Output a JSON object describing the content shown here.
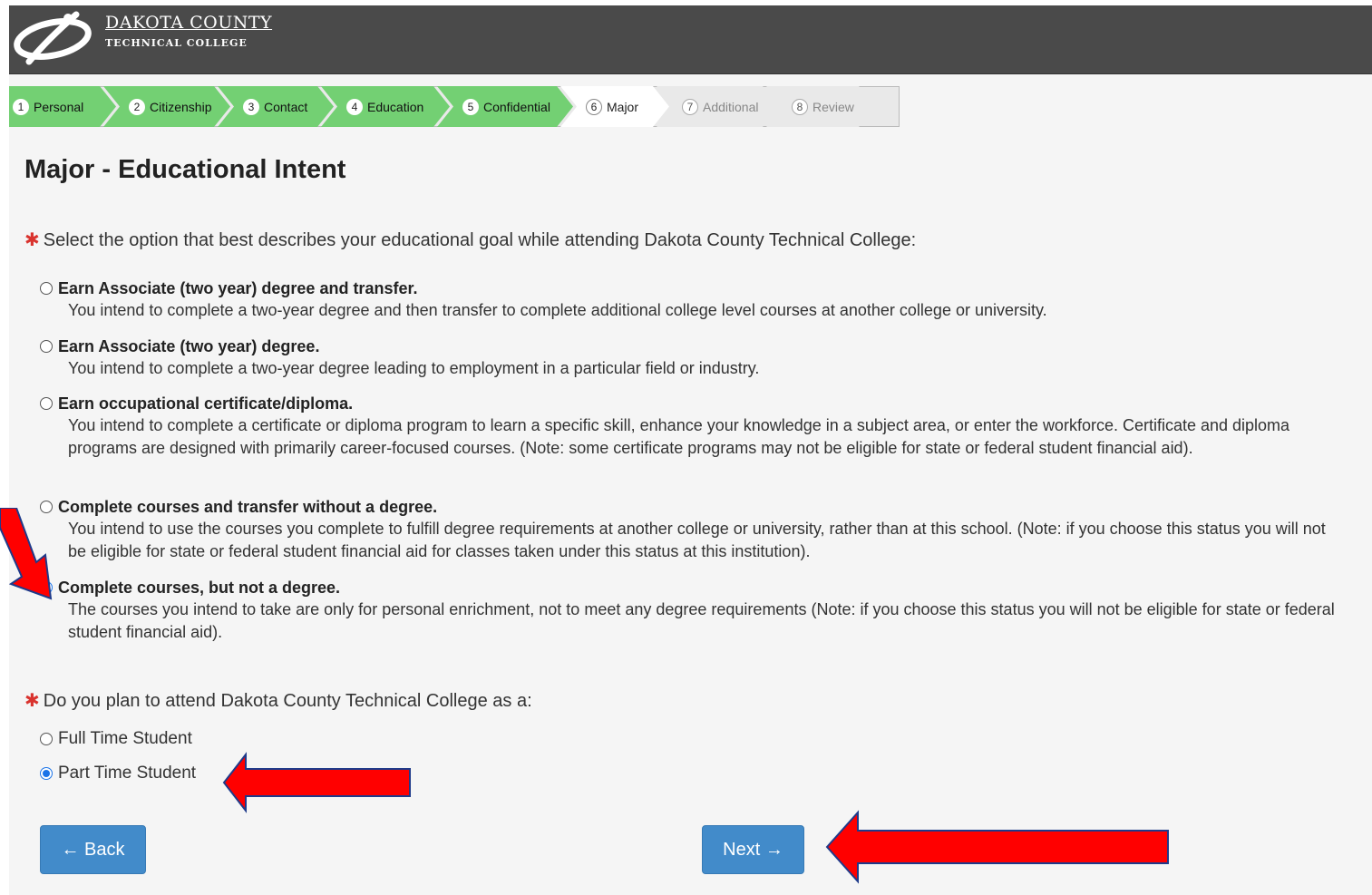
{
  "header": {
    "logo_title": "DAKOTA COUNTY",
    "logo_subtitle": "TECHNICAL COLLEGE"
  },
  "steps": [
    {
      "num": "1",
      "label": "Personal",
      "state": "done"
    },
    {
      "num": "2",
      "label": "Citizenship",
      "state": "done"
    },
    {
      "num": "3",
      "label": "Contact",
      "state": "done"
    },
    {
      "num": "4",
      "label": "Education",
      "state": "done"
    },
    {
      "num": "5",
      "label": "Confidential",
      "state": "done"
    },
    {
      "num": "6",
      "label": "Major",
      "state": "current"
    },
    {
      "num": "7",
      "label": "Additional",
      "state": "future"
    },
    {
      "num": "8",
      "label": "Review",
      "state": "future"
    }
  ],
  "page_title": "Major - Educational Intent",
  "goal_question": {
    "asterisk": "✱",
    "text": "Select the option that best describes your educational goal while attending Dakota County Technical College:"
  },
  "goal_options": [
    {
      "title": "Earn Associate (two year) degree and transfer.",
      "desc": "You intend to complete a two-year degree and then transfer to complete additional college level courses at another college or university.",
      "checked": false
    },
    {
      "title": "Earn Associate (two year) degree.",
      "desc": "You intend to complete a two-year degree leading to employment in a particular field or industry.",
      "checked": false
    },
    {
      "title": "Earn occupational certificate/diploma.",
      "desc": "You intend to complete a certificate or diploma program to learn a specific skill, enhance your knowledge in a subject area, or enter the workforce. Certificate and diploma programs are designed with primarily career-focused courses. (Note: some certificate programs may not be eligible for state or federal student financial aid).",
      "checked": false
    },
    {
      "title": "Complete courses and transfer without a degree.",
      "desc": "You intend to use the courses you complete to fulfill degree requirements at another college or university, rather than at this school. (Note: if you choose this status you will not be eligible for state or federal student financial aid for classes taken under this status at this institution).",
      "checked": false
    },
    {
      "title": "Complete courses, but not a degree.",
      "desc": "The courses you intend to take are only for personal enrichment, not to meet any degree requirements (Note: if you choose this status you will not be eligible for state or federal student financial aid).",
      "checked": true
    }
  ],
  "status_question": {
    "asterisk": "✱",
    "text": "Do you plan to attend Dakota County Technical College as a:"
  },
  "status_options": [
    {
      "label": "Full Time Student",
      "checked": false
    },
    {
      "label": "Part Time Student",
      "checked": true
    }
  ],
  "buttons": {
    "back": "← Back",
    "next": "Next →"
  },
  "colors": {
    "header_bg": "#4a4a4a",
    "step_done": "#73d073",
    "button": "#428bca",
    "asterisk": "#d9332e",
    "annotation_arrow": "#ff0000"
  }
}
